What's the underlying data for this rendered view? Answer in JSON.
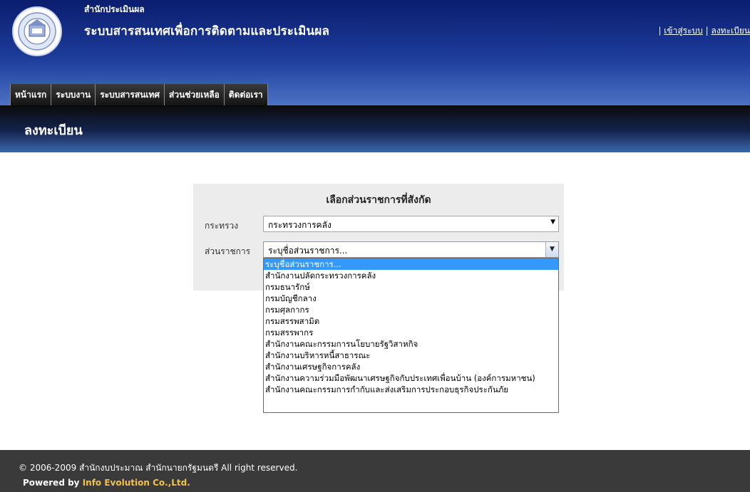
{
  "header": {
    "org_name": "สำนักประเมินผล",
    "system_title": "ระบบสารสนเทศเพื่อการติดตามและประเมินผล",
    "top_links": {
      "sep1": "| ",
      "login": "เข้าสู่ระบบ",
      "sep2": " | ",
      "register": "ลงทะเบียน"
    },
    "logo_icon": "budget-bureau-seal-icon"
  },
  "nav": {
    "items": [
      {
        "label": "หน้าแรก"
      },
      {
        "label": "ระบบงาน"
      },
      {
        "label": "ระบบสารสนเทศ"
      },
      {
        "label": "ส่วนช่วยเหลือ"
      },
      {
        "label": "ติดต่อเรา"
      }
    ]
  },
  "page_title": "ลงทะเบียน",
  "form": {
    "title": "เลือกส่วนราชการที่สังกัด",
    "ministry_label": "กระทรวง",
    "ministry_value": "กระทรวงการคลัง",
    "dept_label": "ส่วนราชการ",
    "dept_value": "ระบุชื่อส่วนราชการ...",
    "dept_options": [
      "ระบุชื่อส่วนราชการ...",
      "สำนักงานปลัดกระทรวงการคลัง",
      "กรมธนารักษ์",
      "กรมบัญชีกลาง",
      "กรมศุลกากร",
      "กรมสรรพสามิต",
      "กรมสรรพากร",
      "สำนักงานคณะกรรมการนโยบายรัฐวิสาหกิจ",
      "สำนักงานบริหารหนี้สาธารณะ",
      "สำนักงานเศรษฐกิจการคลัง",
      "สำนักงานความร่วมมือพัฒนาเศรษฐกิจกับประเทศเพื่อนบ้าน (องค์การมหาชน)",
      "สำนักงานคณะกรรมการกำกับและส่งเสริมการประกอบธุรกิจประกันภัย"
    ],
    "selected_index": 0
  },
  "footer": {
    "copyright": "© 2006-2009 สำนักงบประมาณ สำนักนายกรัฐมนตรี All right reserved.",
    "powered_label": "Powered by",
    "powered_company": "Info Evolution Co.,Ltd."
  },
  "colors": {
    "header_blue": "#1d3c9a",
    "selected_option": "#3399ff",
    "powered_company": "#f0c24a"
  }
}
